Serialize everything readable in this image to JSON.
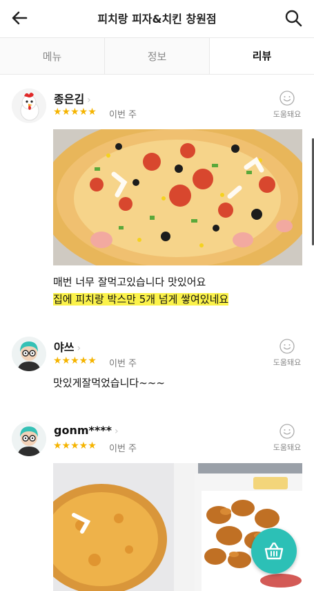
{
  "header": {
    "title": "피치랑 피자&치킨 창원점"
  },
  "tabs": [
    {
      "label": "메뉴",
      "active": false
    },
    {
      "label": "정보",
      "active": false
    },
    {
      "label": "리뷰",
      "active": true
    }
  ],
  "reviews": [
    {
      "name": "종은김",
      "rating": 5,
      "stars": "★★★★★",
      "when": "이번 주",
      "helpful_label": "도움돼요",
      "text_lines": [
        "매번 너무 잘먹고있습니다 맛있어요"
      ],
      "highlight_line": "집에 피치랑 박스만 5개 넘게 쌓여있네요",
      "has_photo": true,
      "avatar": "chicken-avatar"
    },
    {
      "name": "야쓰",
      "rating": 5,
      "stars": "★★★★★",
      "when": "이번 주",
      "helpful_label": "도움돼요",
      "text_lines": [
        "맛있게잘먹었습니다~~~"
      ],
      "has_photo": false,
      "avatar": "teal-hair-glasses-avatar"
    },
    {
      "name": "gonm****",
      "rating": 5,
      "stars": "★★★★★",
      "when": "이번 주",
      "helpful_label": "도움돼요",
      "text_lines": [],
      "has_photo": true,
      "avatar": "teal-hair-glasses-avatar"
    }
  ],
  "colors": {
    "accent": "#2cc0b6",
    "star": "#f5b400",
    "highlight": "#fbf24a"
  },
  "icons": {
    "back": "arrow-left-icon",
    "search": "search-icon",
    "cart": "cart-basket-icon",
    "helpful": "smile-icon"
  }
}
